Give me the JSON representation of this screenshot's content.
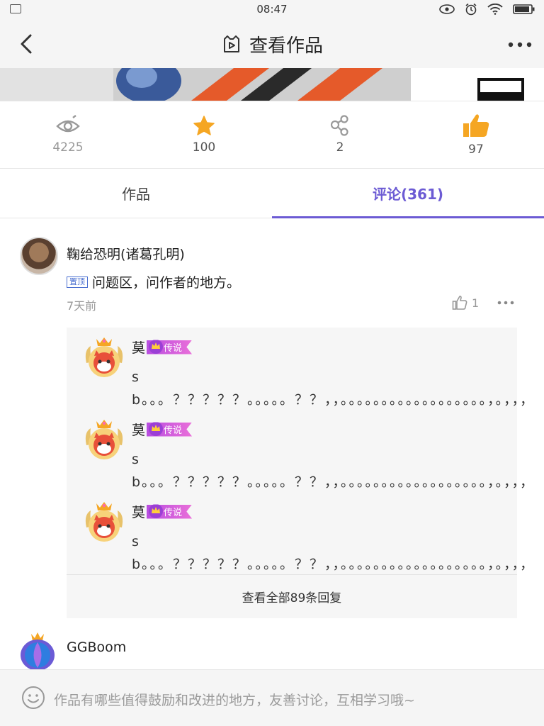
{
  "status_bar": {
    "time": "08:47"
  },
  "header": {
    "title": "查看作品"
  },
  "stats": [
    {
      "icon": "eye-icon",
      "value": "4225"
    },
    {
      "icon": "star-icon",
      "value": "100"
    },
    {
      "icon": "share-icon",
      "value": "2"
    },
    {
      "icon": "thumbs-up-icon",
      "value": "97"
    }
  ],
  "tabs": [
    {
      "label": "作品"
    },
    {
      "label": "评论(361)"
    }
  ],
  "comment": {
    "author": "鞠给恐明(诸葛孔明)",
    "pin_tag": "置顶",
    "text": "问题区，问作者的地方。",
    "time": "7天前",
    "likes": "1"
  },
  "replies": [
    {
      "author": "莫",
      "badge": "传说",
      "text": "sb。。。？？？？？。。。。。？？，，。。。。。。。。。。。。。。。。。。，。，，，"
    },
    {
      "author": "莫",
      "badge": "传说",
      "text": "sb。。。？？？？？。。。。。？？，，。。。。。。。。。。。。。。。。。。，。，，，"
    },
    {
      "author": "莫",
      "badge": "传说",
      "text": "sb。。。？？？？？。。。。。？？，，。。。。。。。。。。。。。。。。。。，。，，，"
    }
  ],
  "view_all_replies": "查看全部89条回复",
  "comment2": {
    "author": "GGBoom"
  },
  "input": {
    "placeholder": "作品有哪些值得鼓励和改进的地方，友善讨论，互相学习哦~"
  },
  "colors": {
    "accent": "#6c5bd4",
    "star": "#f5a623",
    "like": "#f5a623"
  }
}
